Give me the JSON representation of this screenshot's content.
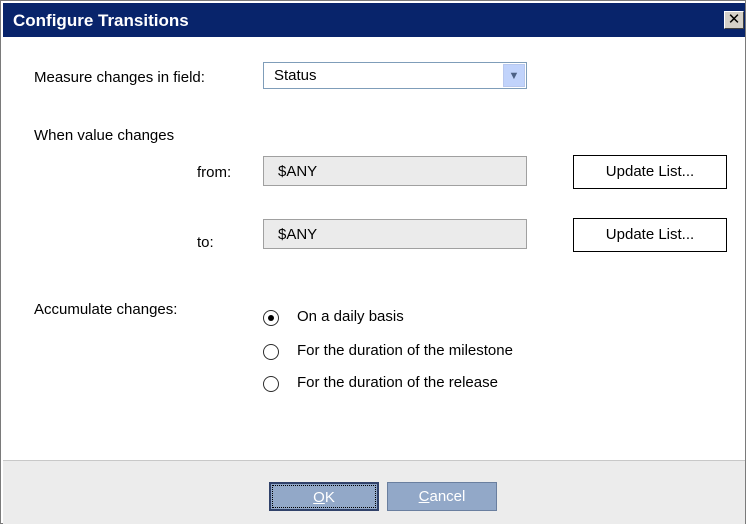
{
  "window": {
    "title": "Configure Transitions",
    "close_icon": "close-icon"
  },
  "measure": {
    "label": "Measure changes in field:",
    "selected": "Status"
  },
  "when": {
    "heading": "When value changes",
    "from_label": "from:",
    "from_value": "$ANY",
    "to_label": "to:",
    "to_value": "$ANY",
    "update_label": "Update List..."
  },
  "accumulate": {
    "label": "Accumulate changes:",
    "options": [
      {
        "label": "On a daily basis",
        "checked": true
      },
      {
        "label": "For the duration of the milestone",
        "checked": false
      },
      {
        "label": "For the duration of the release",
        "checked": false
      }
    ]
  },
  "footer": {
    "ok_key": "O",
    "ok_rest": "K",
    "cancel_key": "C",
    "cancel_rest": "ancel"
  }
}
